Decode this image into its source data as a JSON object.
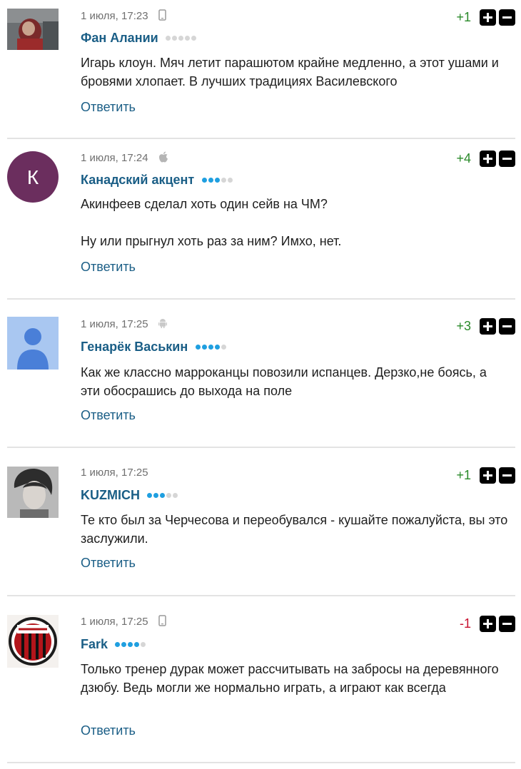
{
  "reply_label": "Ответить",
  "colors": {
    "author": "#1a5e86",
    "positive": "#2a8a2a",
    "negative": "#c8102e",
    "dot_on": "#1f9fe0",
    "dot_off": "#d6d6d6"
  },
  "comments": [
    {
      "date": "1 июля, 17:23",
      "device": "mobile-icon",
      "author": "Фан Алании",
      "rating_active": 0,
      "score": "+1",
      "paragraphs": [
        "Игарь клоун. Мяч летит парашютом крайне медленно, а этот ушами и бровями хлопает. В лучших традициях Василевского"
      ]
    },
    {
      "date": "1 июля, 17:24",
      "device": "apple-icon",
      "author": "Канадский акцент",
      "rating_active": 3,
      "score": "+4",
      "avatar_letter": "К",
      "paragraphs": [
        "Акинфеев сделал хоть один сейв на ЧМ?",
        "Ну или прыгнул хоть раз за ним? Имхо, нет."
      ]
    },
    {
      "date": "1 июля, 17:25",
      "device": "android-icon",
      "author": "Генарёк Васькин",
      "rating_active": 4,
      "score": "+3",
      "paragraphs": [
        "Как же классно марроканцы повозили испанцев. Дерзко,не боясь, а эти обосрашись до выхода на поле"
      ]
    },
    {
      "date": "1 июля, 17:25",
      "device": "",
      "author": "KUZMICH",
      "rating_active": 3,
      "score": "+1",
      "paragraphs": [
        "Те кто был за Черчесова и переобувался - кушайте пожалуйста, вы это заслужили."
      ]
    },
    {
      "date": "1 июля, 17:25",
      "device": "mobile-icon",
      "author": "Fark",
      "rating_active": 4,
      "score": "-1",
      "paragraphs": [
        "Только тренер дурак может рассчитывать на забросы на деревянного дзюбу. Ведь могли же нормально играть, а играют как всегда"
      ]
    }
  ]
}
